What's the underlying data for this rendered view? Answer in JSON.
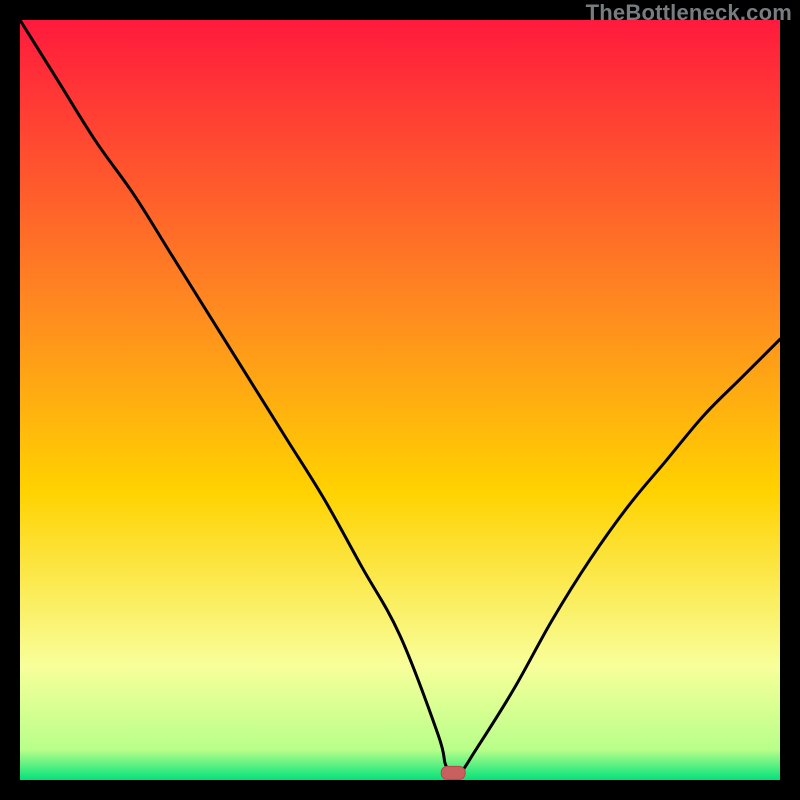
{
  "watermark": "TheBottleneck.com",
  "chart_data": {
    "type": "line",
    "title": "",
    "xlabel": "",
    "ylabel": "",
    "xlim": [
      0,
      100
    ],
    "ylim": [
      0,
      100
    ],
    "grid": false,
    "series": [
      {
        "name": "bottleneck-curve",
        "x": [
          0,
          5,
          10,
          15,
          20,
          25,
          30,
          35,
          40,
          45,
          50,
          55,
          56,
          57,
          58,
          60,
          65,
          70,
          75,
          80,
          85,
          90,
          95,
          100
        ],
        "y": [
          100,
          92,
          84,
          77,
          69,
          61,
          53,
          45,
          37,
          28,
          19,
          6,
          2,
          1,
          1,
          4,
          12,
          21,
          29,
          36,
          42,
          48,
          53,
          58
        ]
      }
    ],
    "marker": {
      "x": 57,
      "y": 1
    },
    "colors": {
      "gradient_top": "#ff1a3d",
      "gradient_mid": "#ffd200",
      "gradient_low": "#f8ff9a",
      "gradient_bottom": "#04e27a",
      "curve": "#000000",
      "marker_fill": "#c8605f",
      "marker_stroke": "#b24a49"
    }
  }
}
